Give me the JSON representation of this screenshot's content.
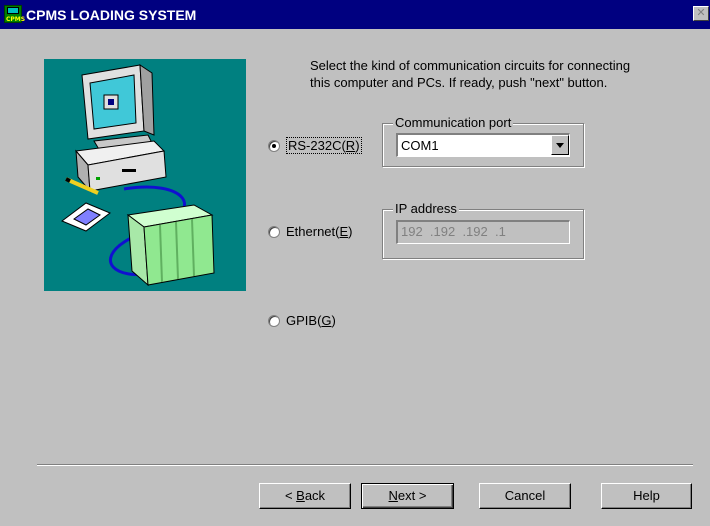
{
  "window": {
    "title": "CPMS LOADING SYSTEM",
    "icon_name": "cpms-app-icon",
    "icon_text": "CPMS",
    "close_icon": "close-icon"
  },
  "instructions": {
    "line1": "Select the kind of communication circuits for connecting",
    "line2": "this computer and PCs. If ready, push \"next\" button."
  },
  "options": {
    "rs232c": {
      "prefix": "RS-232C(",
      "mnemonic": "R",
      "suffix": ")",
      "checked": true
    },
    "ethernet": {
      "prefix": "Ethernet(",
      "mnemonic": "E",
      "suffix": ")",
      "checked": false
    },
    "gpib": {
      "prefix": "GPIB(",
      "mnemonic": "G",
      "suffix": ")",
      "checked": false
    }
  },
  "comm_port": {
    "group_label": "Communication port",
    "selected": "COM1"
  },
  "ip_address": {
    "group_label": "IP address",
    "value": "192  .192  .192  .1"
  },
  "buttons": {
    "back": {
      "prefix": "< ",
      "mnemonic": "B",
      "suffix": "ack"
    },
    "next": {
      "mnemonic": "N",
      "suffix": "ext >"
    },
    "cancel": "Cancel",
    "help": "Help"
  },
  "colors": {
    "title_bar": "#000080",
    "dialog_bg": "#c0c0c0",
    "illustration_bg": "#008080",
    "plc_green": "#90e890",
    "monitor_screen": "#40c8d8"
  }
}
